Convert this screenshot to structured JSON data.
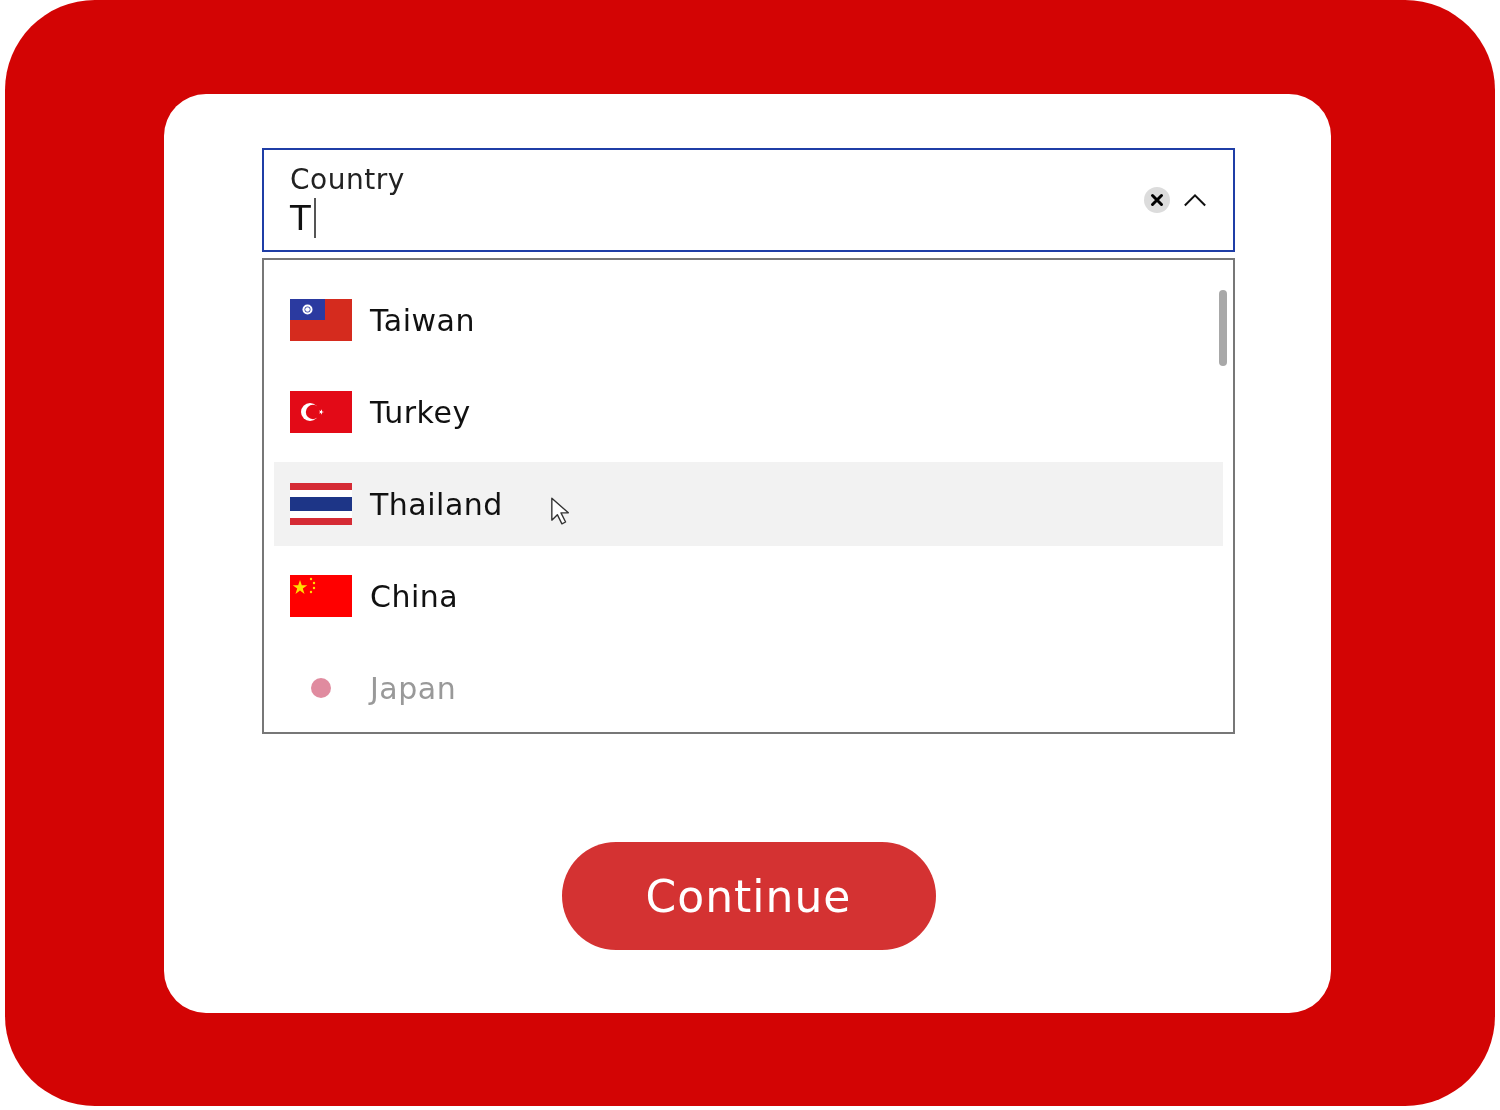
{
  "field": {
    "label": "Country",
    "value": "T"
  },
  "options": [
    {
      "name": "Taiwan",
      "kind": "tw",
      "selected": false,
      "faded": false
    },
    {
      "name": "Turkey",
      "kind": "tr",
      "selected": false,
      "faded": false
    },
    {
      "name": "Thailand",
      "kind": "th",
      "selected": true,
      "faded": false
    },
    {
      "name": "China",
      "kind": "cn",
      "selected": false,
      "faded": false
    },
    {
      "name": "Japan",
      "kind": "jp",
      "selected": false,
      "faded": true
    }
  ],
  "button": "Continue"
}
